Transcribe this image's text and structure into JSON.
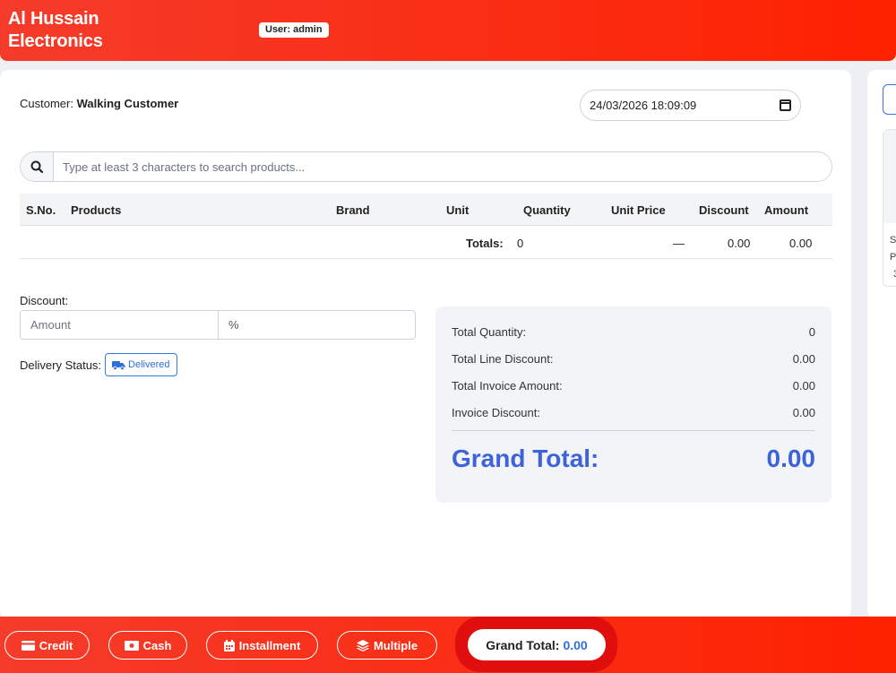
{
  "header": {
    "brand_line1": "Al Hussain",
    "brand_line2": "Electronics",
    "user_badge": "User: admin"
  },
  "invoice": {
    "customer_label": "Customer:",
    "customer_name": "Walking Customer",
    "datetime": "24/03/2026 18:09:09"
  },
  "search": {
    "placeholder": "Type at least 3 characters to search products..."
  },
  "table": {
    "headers": [
      "S.No.",
      "Products",
      "Brand",
      "Unit",
      "Quantity",
      "Unit Price",
      "Discount",
      "Amount"
    ],
    "totals_label": "Totals:",
    "totals_quantity": "0",
    "totals_unit_price": "—",
    "totals_discount": "0.00",
    "totals_amount": "0.00"
  },
  "discount": {
    "label": "Discount:",
    "amount_placeholder": "Amount",
    "percent_placeholder": "%"
  },
  "delivery": {
    "label": "Delivery Status:",
    "status": "Delivered"
  },
  "summary": {
    "total_quantity_label": "Total Quantity:",
    "total_quantity": "0",
    "total_line_discount_label": "Total Line Discount:",
    "total_line_discount": "0.00",
    "total_invoice_amount_label": "Total Invoice Amount:",
    "total_invoice_amount": "0.00",
    "invoice_discount_label": "Invoice Discount:",
    "invoice_discount": "0.00",
    "grand_total_label": "Grand Total:",
    "grand_total": "0.00"
  },
  "side_panel": {
    "partial_text": [
      "S",
      "P",
      "3"
    ]
  },
  "footer": {
    "credit_label": "Credit",
    "cash_label": "Cash",
    "installment_label": "Installment",
    "multiple_label": "Multiple",
    "grand_total_label": "Grand Total:",
    "grand_total_value": "0.00"
  },
  "colors": {
    "header_red": "#f53b2a",
    "accent_blue": "#3d63db"
  }
}
